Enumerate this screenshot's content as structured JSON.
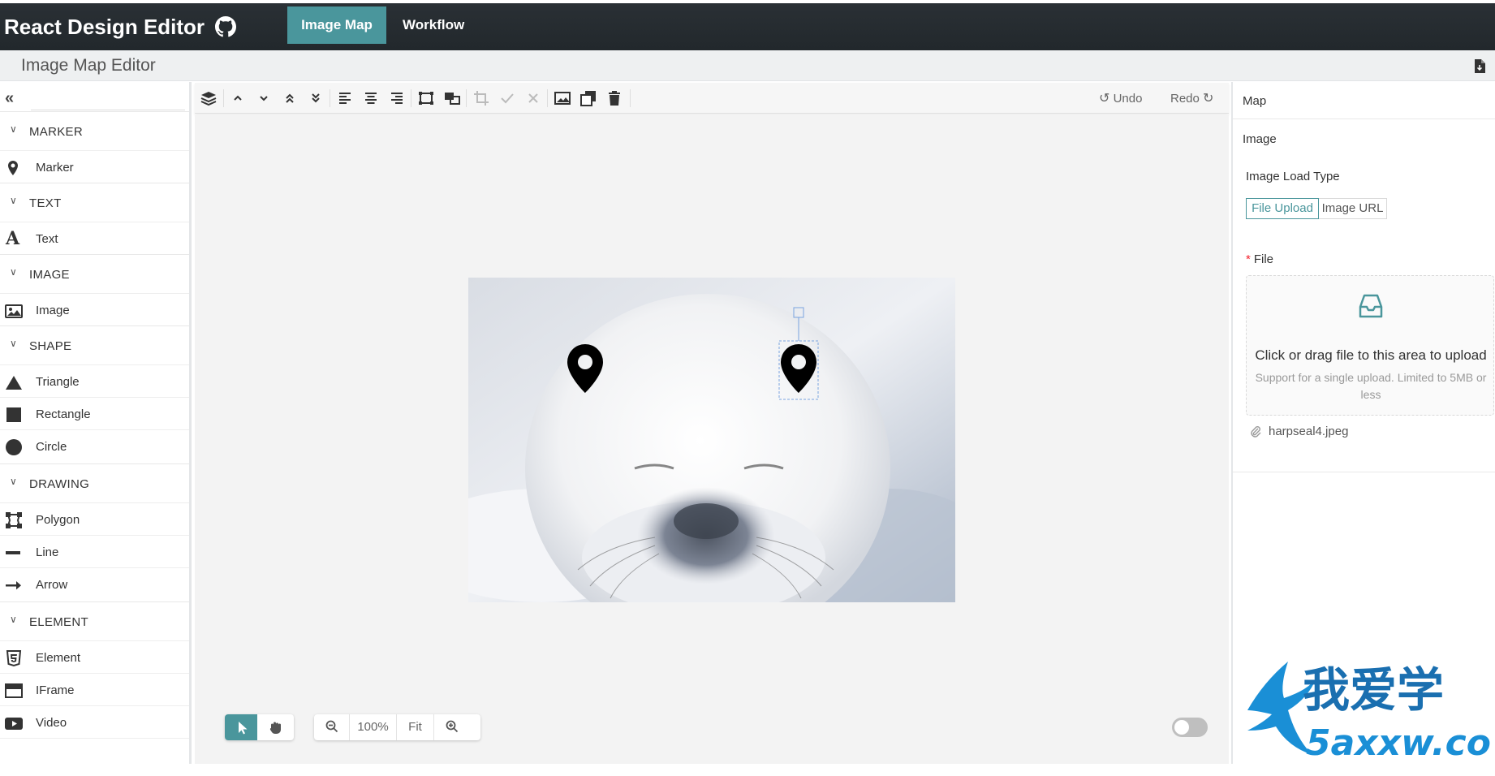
{
  "nav": {
    "brand": "React Design Editor",
    "tabs": [
      {
        "label": "Image Map",
        "active": true
      },
      {
        "label": "Workflow",
        "active": false
      }
    ]
  },
  "titlebar": {
    "title": "Image Map Editor"
  },
  "sidebar": {
    "categories": [
      {
        "label": "MARKER",
        "items": [
          {
            "label": "Marker",
            "icon": "map-marker-icon"
          }
        ]
      },
      {
        "label": "TEXT",
        "items": [
          {
            "label": "Text",
            "icon": "font-icon"
          }
        ]
      },
      {
        "label": "IMAGE",
        "items": [
          {
            "label": "Image",
            "icon": "image-icon"
          }
        ]
      },
      {
        "label": "SHAPE",
        "items": [
          {
            "label": "Triangle",
            "icon": "triangle-icon"
          },
          {
            "label": "Rectangle",
            "icon": "square-icon"
          },
          {
            "label": "Circle",
            "icon": "circle-icon"
          }
        ]
      },
      {
        "label": "DRAWING",
        "items": [
          {
            "label": "Polygon",
            "icon": "polygon-icon"
          },
          {
            "label": "Line",
            "icon": "line-icon"
          },
          {
            "label": "Arrow",
            "icon": "arrow-right-icon"
          }
        ]
      },
      {
        "label": "ELEMENT",
        "items": [
          {
            "label": "Element",
            "icon": "html5-icon"
          },
          {
            "label": "IFrame",
            "icon": "window-icon"
          },
          {
            "label": "Video",
            "icon": "video-icon"
          }
        ]
      }
    ]
  },
  "toolbar": {
    "undo_label": "Undo",
    "redo_label": "Redo"
  },
  "zoom": {
    "out_icon": "zoom-out-icon",
    "level": "100%",
    "fit_label": "Fit",
    "in_icon": "zoom-in-icon"
  },
  "panel": {
    "map_label": "Map",
    "image_label": "Image",
    "load_type_label": "Image Load Type",
    "load_types": [
      "File Upload",
      "Image URL"
    ],
    "selected_load_type": "File Upload",
    "required_mark": "*",
    "file_label": "File",
    "drop_text": "Click or drag file to this area to upload",
    "drop_hint": "Support for a single upload. Limited to 5MB or less",
    "file_name": "harpseal4.jpeg"
  },
  "colors": {
    "accent": "#4a969c",
    "nav_bg": "#23292e",
    "canvas_bg": "#f3f3f3"
  },
  "watermark": {
    "text_cn": "我爱学",
    "text_en": "5axxw.co"
  }
}
